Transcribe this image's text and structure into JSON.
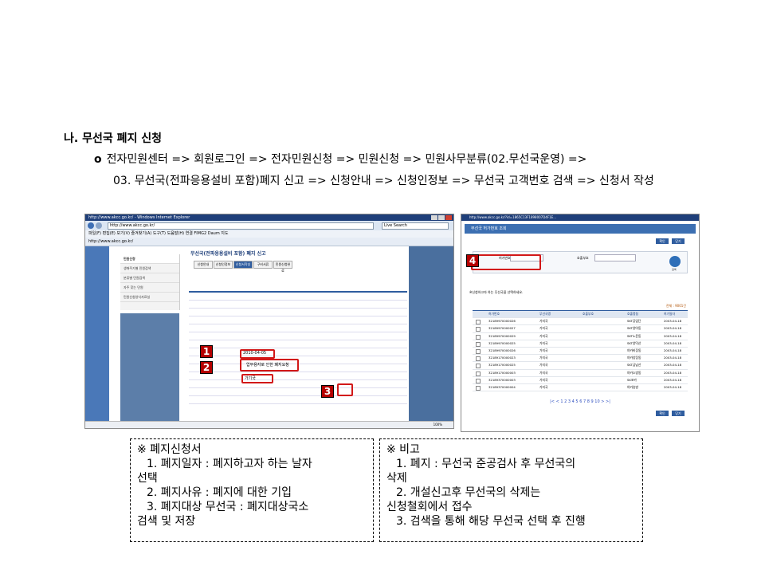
{
  "section": {
    "heading": "나. 무선국 폐지 신청",
    "bullet": "o",
    "path_line1": "전자민원센터 => 회원로그인 => 전자민원신청 => 민원신청 => 민원사무분류(02.무선국운영) =>",
    "path_line2": "03. 무선국(전파응용설비 포함)폐지 신고 => 신청안내 => 신청인정보 => 무선국 고객번호 검색 => 신청서 작성"
  },
  "screenshot1": {
    "title_bar": "http://www.akcc.go.kr/ - Windows Internet Explorer",
    "address": "http://www.akcc.go.kr/",
    "search_placeholder": "Live Search",
    "menu": "파일(F)  편집(E)  보기(V)  즐겨찾기(A)  도구(T)  도움말(H)     연결  FIMG2  Daum 지도",
    "favorite_tab": "http://www.akcc.go.kr/",
    "page_title": "무선국(전파응용설비 포함) 폐지 신고",
    "nav_items": [
      "민원신청",
      "생애주기별 민원검색",
      "분류별 민원검색",
      "자주 찾는 민원",
      "민원신청양식자료실"
    ],
    "tabs": [
      "신청안내",
      "신청인정보",
      "신청서작성",
      "구비서류",
      "민원신청완료"
    ],
    "field_date": "2010-04-05",
    "field_reason": "업무용자로 인한 폐지요청",
    "field_station": "가기국",
    "status_zoom": "100%",
    "markers": [
      "1",
      "2",
      "3"
    ]
  },
  "screenshot2": {
    "title_bar": "http://www.akcc.go.kr/?id=1865C13F1898007D4F1E...",
    "header": "무선국 허가번호 조회",
    "buttons": [
      "확인",
      "닫기"
    ],
    "marker": "4",
    "search_label_1": "허가번호",
    "search_label_2": "호출부호",
    "search_button": "검색",
    "hint": "※신청하고자 하는 무선국을 선택하세요.",
    "total": "전체 : 9001건",
    "columns": [
      "허가번호",
      "무선국명",
      "호출부호",
      "호출명칭",
      "허가일자"
    ],
    "rows": [
      [
        "32189970000026",
        "가지국",
        "",
        "SKT공업단",
        "2003-04-18"
      ],
      [
        "32189970000027",
        "가지국",
        "",
        "SKT양아동",
        "2003-04-18"
      ],
      [
        "32189970000029",
        "가지국",
        "",
        "SKT노윤동",
        "2003-04-18"
      ],
      [
        "32189970000025",
        "가지국",
        "",
        "SKT양덕산",
        "2003-04-18"
      ],
      [
        "32189970000026",
        "가지국",
        "",
        "야카비장동",
        "2003-04-18"
      ],
      [
        "32189170000023",
        "가지국",
        "",
        "야카양장동",
        "2003-04-18"
      ],
      [
        "32189170000025",
        "가지국",
        "",
        "SKT금남산",
        "2003-04-18"
      ],
      [
        "32189170000003",
        "가지국",
        "",
        "야카소방동",
        "2003-04-18"
      ],
      [
        "32189370000003",
        "가지국",
        "",
        "SK포카",
        "2003-04-18"
      ],
      [
        "32189370000004",
        "가지국",
        "",
        "야카송방",
        "2003-04-18"
      ]
    ],
    "pager": "|< < 1 2 3 4 5 6 7 8 9 10 > >|",
    "bottom_buttons": [
      "확인",
      "닫기"
    ]
  },
  "note1": {
    "title": "※ 폐지신청서",
    "line1a": "1. 폐지일자 : 폐지하고자 하는 날자",
    "line1b": "선택",
    "line2": "2. 폐지사유 : 폐지에 대한 기입",
    "line3a": "3. 폐지대상 무선국 : 폐지대상국소",
    "line3b": "검색 및 저장"
  },
  "note2": {
    "title": "※ 비고",
    "line1a": "1. 폐지 : 무선국 준공검사 후 무선국의",
    "line1b": "삭제",
    "line2a": "2. 개설신고후 무선국의 삭제는",
    "line2b": "신청철회에서 접수",
    "line3": "3. 검색을 통해 해당 무선국 선택 후 진행"
  }
}
